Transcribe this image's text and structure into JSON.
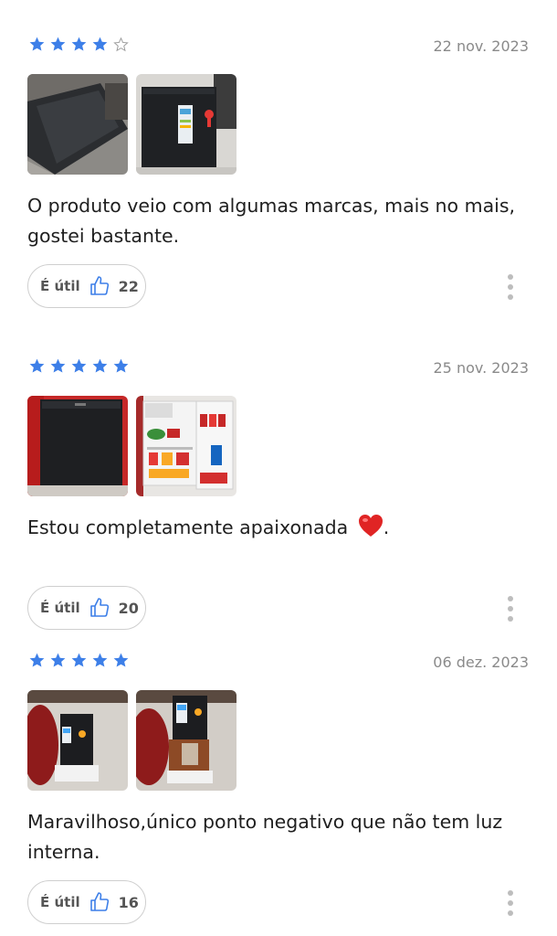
{
  "star_color": "#3d7fe8",
  "reviews": [
    {
      "rating": 4,
      "date": "22 nov. 2023",
      "photos": [
        "fridge-top-view-photo",
        "fridge-front-photo"
      ],
      "text": "O produto veio com algumas marcas, mais no mais, gostei bastante.",
      "useful_label": "É útil",
      "useful_count": "22"
    },
    {
      "rating": 5,
      "date": "25 nov. 2023",
      "photos": [
        "fridge-closed-photo",
        "fridge-open-photo"
      ],
      "text": "Estou completamente apaixonada",
      "text_suffix": ".",
      "emoji": "heart-emoji",
      "useful_label": "É útil",
      "useful_count": "20"
    },
    {
      "rating": 5,
      "date": "06 dez. 2023",
      "photos": [
        "fridge-in-room-photo",
        "fridge-in-room-open-photo"
      ],
      "text": "Maravilhoso,único ponto negativo que não tem luz interna.",
      "useful_label": "É útil",
      "useful_count": "16"
    }
  ]
}
